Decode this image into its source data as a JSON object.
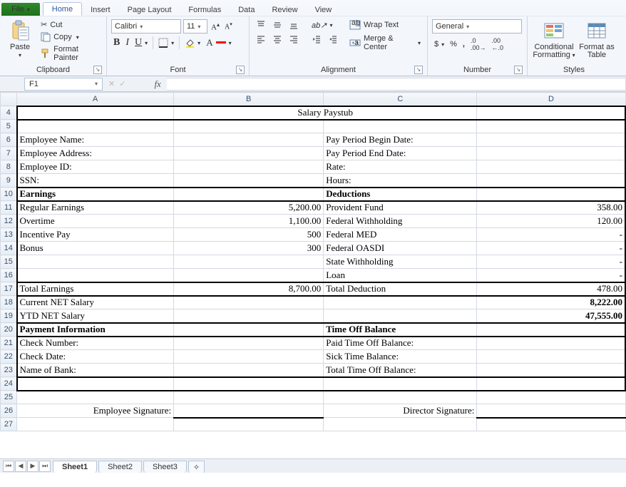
{
  "ribbon": {
    "tabs": {
      "file": "File",
      "home": "Home",
      "insert": "Insert",
      "pageLayout": "Page Layout",
      "formulas": "Formulas",
      "data": "Data",
      "review": "Review",
      "view": "View"
    },
    "clipboard": {
      "paste": "Paste",
      "cut": "Cut",
      "copy": "Copy",
      "formatPainter": "Format Painter",
      "label": "Clipboard"
    },
    "font": {
      "name": "Calibri",
      "size": "11",
      "bold": "B",
      "italic": "I",
      "underline": "U",
      "label": "Font"
    },
    "alignment": {
      "wrap": "Wrap Text",
      "merge": "Merge & Center",
      "label": "Alignment"
    },
    "number": {
      "format": "General",
      "label": "Number"
    },
    "styles": {
      "cond": "Conditional Formatting",
      "fmt": "Format as Table",
      "label": "Styles"
    }
  },
  "namebox": "F1",
  "cells": {
    "title": "Salary Paystub",
    "r6a": "Employee Name:",
    "r6c": "Pay Period Begin Date:",
    "r7a": "Employee Address:",
    "r7c": "Pay Period End Date:",
    "r8a": "Employee ID:",
    "r8c": "Rate:",
    "r9a": "SSN:",
    "r9c": "Hours:",
    "r10a": "Earnings",
    "r10c": "Deductions",
    "r11a": "Regular Earnings",
    "r11b": "5,200.00",
    "r11c": "Provident Fund",
    "r11d": "358.00",
    "r12a": "Overtime",
    "r12b": "1,100.00",
    "r12c": "Federal Withholding",
    "r12d": "120.00",
    "r13a": "Incentive Pay",
    "r13b": "500",
    "r13c": "Federal MED",
    "r13d": "-",
    "r14a": "Bonus",
    "r14b": "300",
    "r14c": "Federal OASDI",
    "r14d": "-",
    "r15c": "State Withholding",
    "r15d": "-",
    "r16c": "Loan",
    "r16d": "-",
    "r17a": "Total Earnings",
    "r17b": "8,700.00",
    "r17c": "Total Deduction",
    "r17d": "478.00",
    "r18a": "Current NET Salary",
    "r18d": "8,222.00",
    "r19a": "YTD NET Salary",
    "r19d": "47,555.00",
    "r20a": "Payment Information",
    "r20c": "Time Off Balance",
    "r21a": "Check  Number:",
    "r21c": "Paid Time Off Balance:",
    "r22a": "Check Date:",
    "r22c": "Sick Time Balance:",
    "r23a": "Name of Bank:",
    "r23c": "Total Time Off Balance:",
    "r26a": "Employee Signature:",
    "r26c": "Director  Signature:"
  },
  "sheets": {
    "s1": "Sheet1",
    "s2": "Sheet2",
    "s3": "Sheet3"
  },
  "chart_data": {
    "type": "table",
    "title": "Salary Paystub",
    "earnings": [
      {
        "label": "Regular Earnings",
        "value": 5200.0
      },
      {
        "label": "Overtime",
        "value": 1100.0
      },
      {
        "label": "Incentive Pay",
        "value": 500
      },
      {
        "label": "Bonus",
        "value": 300
      }
    ],
    "total_earnings": 8700.0,
    "deductions": [
      {
        "label": "Provident Fund",
        "value": 358.0
      },
      {
        "label": "Federal Withholding",
        "value": 120.0
      },
      {
        "label": "Federal MED",
        "value": null
      },
      {
        "label": "Federal OASDI",
        "value": null
      },
      {
        "label": "State Withholding",
        "value": null
      },
      {
        "label": "Loan",
        "value": null
      }
    ],
    "total_deduction": 478.0,
    "current_net_salary": 8222.0,
    "ytd_net_salary": 47555.0
  }
}
